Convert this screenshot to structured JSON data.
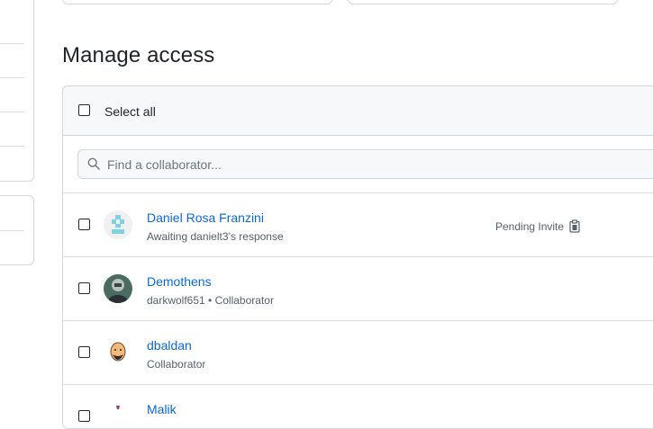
{
  "page": {
    "title": "Manage access"
  },
  "toolbar": {
    "select_all_label": "Select all"
  },
  "search": {
    "placeholder": "Find a collaborator..."
  },
  "collaborators": [
    {
      "name": "Daniel Rosa Franzini",
      "subtitle": "Awaiting danielt3’s response",
      "status": "Pending Invite",
      "avatar_icon": "identicon-avatar"
    },
    {
      "name": "Demothens",
      "subtitle": "darkwolf651 • Collaborator",
      "avatar_icon": "photo-avatar"
    },
    {
      "name": "dbaldan",
      "subtitle": "Collaborator",
      "avatar_icon": "cartoon-face-avatar"
    },
    {
      "name": "Malik",
      "avatar_icon": "avatar"
    }
  ],
  "colors": {
    "link": "#0969da",
    "muted": "#57606a",
    "border": "#d0d7de",
    "header_bg": "#f6f8fa"
  }
}
